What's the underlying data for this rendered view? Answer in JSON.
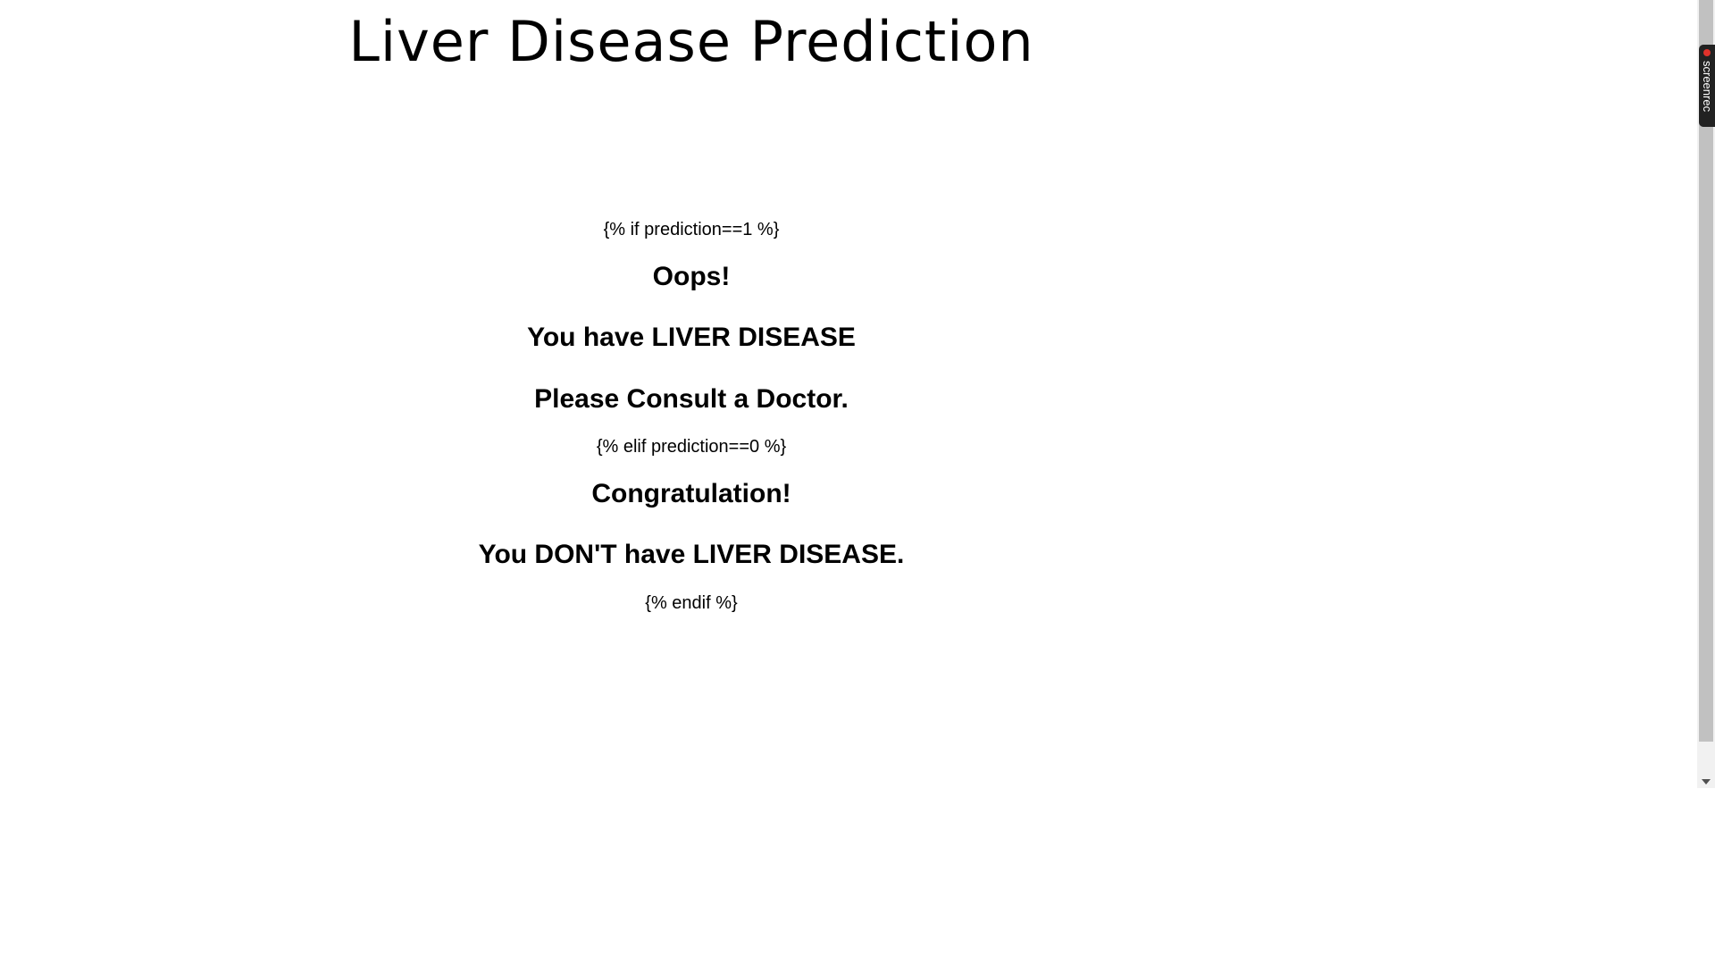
{
  "page": {
    "title": "Liver Disease Prediction",
    "if_tag": "{% if prediction==1 %}",
    "oops": "Oops!",
    "positive_msg": "You have LIVER DISEASE",
    "consult_msg": "Please Consult a Doctor.",
    "elif_tag": "{% elif prediction==0 %}",
    "congrats": "Congratulation!",
    "negative_msg": "You DON'T have LIVER DISEASE.",
    "endif_tag": "{% endif %}"
  },
  "overlay": {
    "badge_label": "screenrec",
    "badge_icon": "record-dot-icon",
    "badge_dot_color": "#e0322b"
  }
}
